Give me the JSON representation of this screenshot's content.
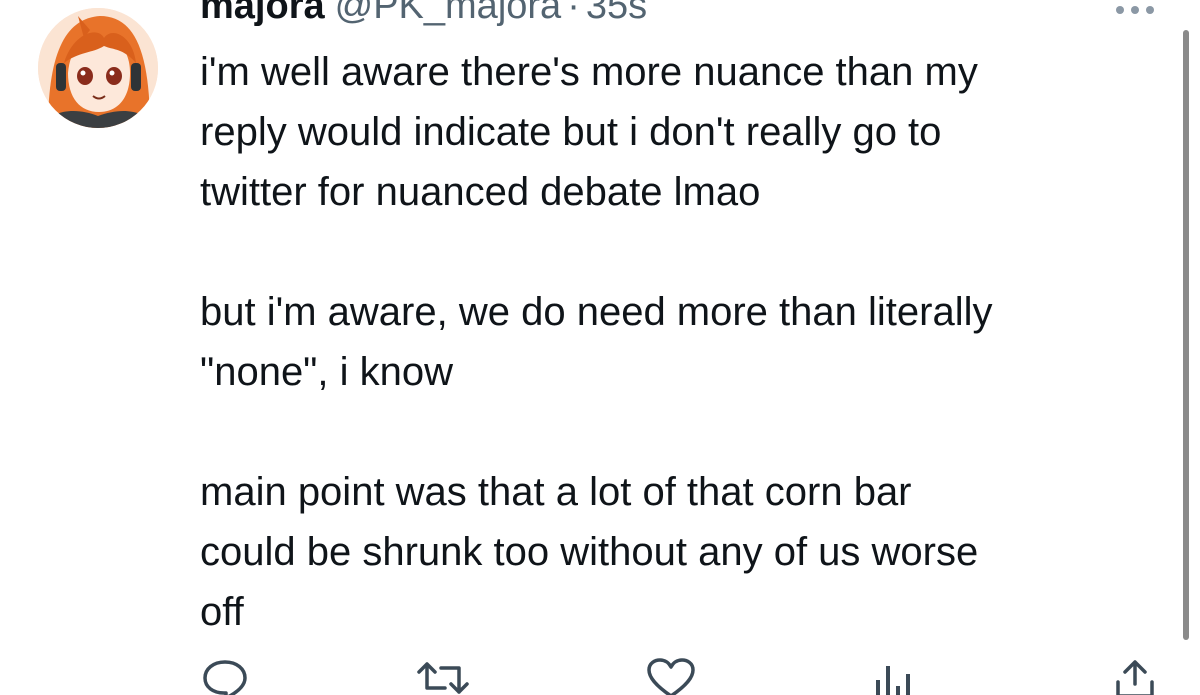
{
  "author": {
    "display_name": "majora",
    "handle": "@PK_majora",
    "separator": "·",
    "timestamp": "35s",
    "avatar_icon": "anime-avatar"
  },
  "tweet": {
    "paragraphs": [
      "i'm well aware there's more nuance than my\nreply would indicate but i don't really go to\ntwitter for nuanced debate lmao",
      "but i'm aware, we do need more than literally\n\"none\", i know",
      "main point was that a lot of that corn bar\ncould be shrunk too without any of us worse\noff"
    ]
  },
  "actions": [
    "reply-icon",
    "retweet-icon",
    "like-icon",
    "analytics-icon",
    "share-icon"
  ],
  "colors": {
    "text": "#0f1419",
    "secondary": "#536471",
    "avatar_hair": "#e8732a"
  }
}
